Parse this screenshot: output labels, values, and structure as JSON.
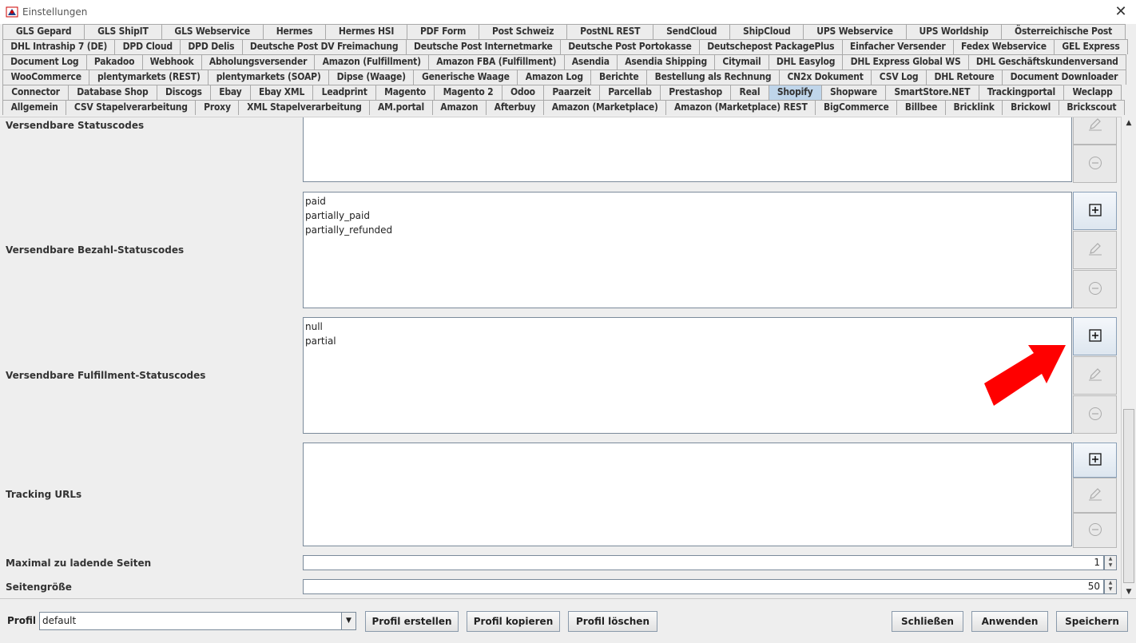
{
  "window": {
    "title": "Einstellungen",
    "close_glyph": "✕",
    "icon": "java-app-icon"
  },
  "tabs": {
    "selected": "Shopify",
    "rows": [
      [
        "GLS Gepard",
        "GLS ShipIT",
        "GLS Webservice",
        "Hermes",
        "Hermes HSI",
        "PDF Form",
        "Post Schweiz",
        "PostNL REST",
        "SendCloud",
        "ShipCloud",
        "UPS Webservice",
        "UPS Worldship",
        "Österreichische Post"
      ],
      [
        "DHL Intraship 7 (DE)",
        "DPD Cloud",
        "DPD Delis",
        "Deutsche Post DV Freimachung",
        "Deutsche Post Internetmarke",
        "Deutsche Post Portokasse",
        "Deutschepost PackagePlus",
        "Einfacher Versender",
        "Fedex Webservice",
        "GEL Express"
      ],
      [
        "Document Log",
        "Pakadoo",
        "Webhook",
        "Abholungsversender",
        "Amazon (Fulfillment)",
        "Amazon FBA (Fulfillment)",
        "Asendia",
        "Asendia Shipping",
        "Citymail",
        "DHL Easylog",
        "DHL Express Global WS",
        "DHL Geschäftskundenversand"
      ],
      [
        "WooCommerce",
        "plentymarkets (REST)",
        "plentymarkets (SOAP)",
        "Dipse (Waage)",
        "Generische Waage",
        "Amazon Log",
        "Berichte",
        "Bestellung als Rechnung",
        "CN2x Dokument",
        "CSV Log",
        "DHL Retoure",
        "Document Downloader"
      ],
      [
        "Connector",
        "Database Shop",
        "Discogs",
        "Ebay",
        "Ebay XML",
        "Leadprint",
        "Magento",
        "Magento 2",
        "Odoo",
        "Paarzeit",
        "Parcellab",
        "Prestashop",
        "Real",
        "Shopify",
        "Shopware",
        "SmartStore.NET",
        "Trackingportal",
        "Weclapp"
      ],
      [
        "Allgemein",
        "CSV Stapelverarbeitung",
        "Proxy",
        "XML Stapelverarbeitung",
        "AM.portal",
        "Amazon",
        "Afterbuy",
        "Amazon (Marketplace)",
        "Amazon (Marketplace) REST",
        "BigCommerce",
        "Billbee",
        "Bricklink",
        "Brickowl",
        "Brickscout"
      ]
    ]
  },
  "fields": {
    "status_codes": {
      "label": "Versendbare Statuscodes",
      "items": []
    },
    "payment_status_codes": {
      "label": "Versendbare Bezahl-Statuscodes",
      "items": [
        "paid",
        "partially_paid",
        "partially_refunded"
      ]
    },
    "fulfillment_status_codes": {
      "label": "Versendbare Fulfillment-Statuscodes",
      "items": [
        "null",
        "partial"
      ]
    },
    "tracking_urls": {
      "label": "Tracking URLs",
      "items": []
    },
    "max_pages": {
      "label": "Maximal zu ladende Seiten",
      "value": "1"
    },
    "page_size": {
      "label": "Seitengröße",
      "value": "50"
    }
  },
  "icons": {
    "add": "plus-box-icon",
    "edit": "pencil-icon",
    "remove": "minus-circle-icon",
    "annotation": "red-arrow-icon"
  },
  "colors": {
    "selected_tab": "#bfd5ea",
    "annotation_arrow": "#ff0000"
  },
  "bottom": {
    "profile_label": "Profil",
    "profile_value": "default",
    "create_profile": "Profil erstellen",
    "copy_profile": "Profil kopieren",
    "delete_profile": "Profil löschen",
    "close": "Schließen",
    "apply": "Anwenden",
    "save": "Speichern"
  }
}
